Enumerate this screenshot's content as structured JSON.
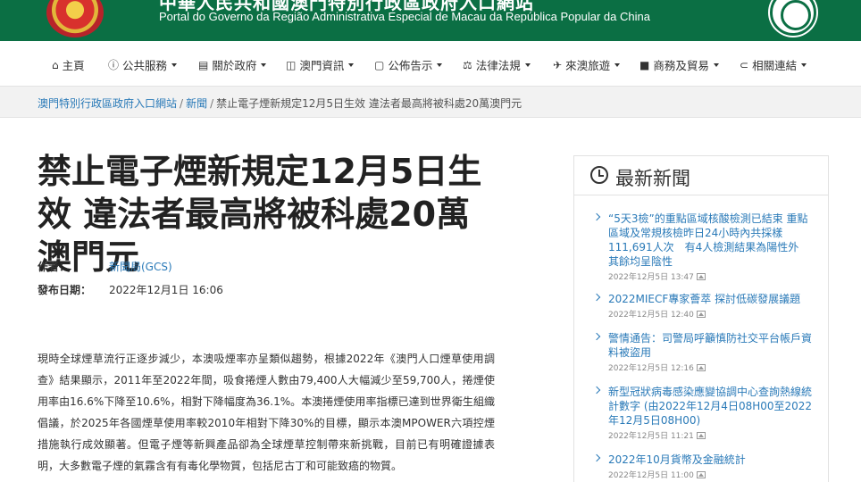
{
  "header": {
    "cut_title": "中華人民共和國澳門特別行政區政府入口網站",
    "portal_name": "Portal do Governo da Região Administrativa Especial de Macau da República Popular da China"
  },
  "nav": {
    "items": [
      {
        "label": "主頁",
        "icon": "home-icon"
      },
      {
        "label": "公共服務",
        "icon": "info-icon"
      },
      {
        "label": "關於政府",
        "icon": "book-icon"
      },
      {
        "label": "澳門資訊",
        "icon": "map-icon"
      },
      {
        "label": "公佈告示",
        "icon": "notice-icon"
      },
      {
        "label": "法律法規",
        "icon": "scale-icon"
      },
      {
        "label": "來澳旅遊",
        "icon": "plane-icon"
      },
      {
        "label": "商務及貿易",
        "icon": "briefcase-icon"
      },
      {
        "label": "相關連結",
        "icon": "link-icon"
      }
    ]
  },
  "breadcrumb": {
    "home": "澳門特別行政區政府入口網站",
    "section": "新聞",
    "current": "禁止電子煙新規定12月5日生效 違法者最高將被科處20萬澳門元"
  },
  "article": {
    "title": "禁止電子煙新規定12月5日生效 違法者最高將被科處20萬澳門元",
    "author_label": "作者：",
    "author_value": "新聞局(GCS)",
    "date_label": "發布日期：",
    "date_value": "2022年12月1日 16:06",
    "body": "現時全球煙草流行正逐步減少，本澳吸煙率亦呈類似趨勢，根據2022年《澳門人口煙草使用調查》結果顯示，2011年至2022年間，吸食捲煙人數由79,400人大幅減少至59,700人，捲煙使用率由16.6%下降至10.6%，相對下降幅度為36.1%。本澳捲煙使用率指標已達到世界衛生組織倡議，於2025年各國煙草使用率較2010年相對下降30%的目標，顯示本澳MPOWER六項控煙措施執行成效顯著。但電子煙等新興產品卻為全球煙草控制帶來新挑戰，目前已有明確證據表明，大多數電子煙的氣霧含有有毒化學物質，包括尼古丁和可能致癌的物質。"
  },
  "sidebar": {
    "title": "最新新聞",
    "items": [
      {
        "headline": "“5天3檢”的重點區域核酸檢測已結束 重點區域及常規核檢昨日24小時內共採樣111,691人次　有4人檢測結果為陽性外　其餘均呈陰性",
        "date": "2022年12月5日 13:47"
      },
      {
        "headline": "2022MIECF專家薈萃 探討低碳發展議題",
        "date": "2022年12月5日 12:40"
      },
      {
        "headline": "警情通告：司警局呼籲慎防社交平台帳戶資料被盜用",
        "date": "2022年12月5日 12:16"
      },
      {
        "headline": "新型冠狀病毒感染應變協調中心查詢熱線統計數字 (由2022年12月4日08H00至2022年12月5日08H00)",
        "date": "2022年12月5日 11:21"
      },
      {
        "headline": "2022年10月貨幣及金融統計",
        "date": "2022年12月5日 11:00"
      }
    ]
  },
  "colors": {
    "brand_green": "#0b6f44",
    "link_blue": "#2a7ab8"
  }
}
